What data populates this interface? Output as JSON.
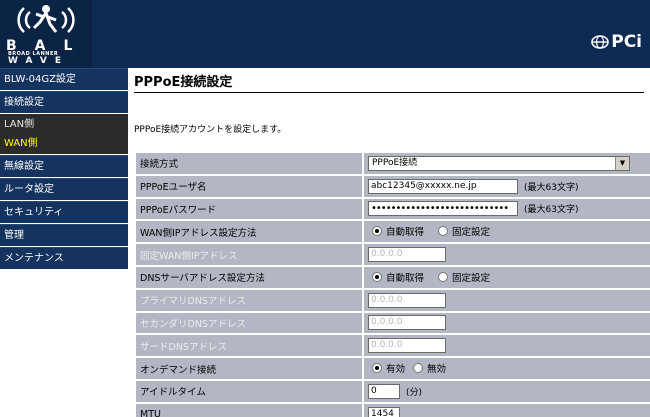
{
  "header": {
    "logo_line1": "BAL",
    "logo_line2": "BROAD LANNER",
    "logo_line3": "WAVE",
    "brand": "PCi"
  },
  "sidebar": {
    "items": [
      {
        "label": "BLW-04GZ設定",
        "type": "main"
      },
      {
        "label": "接続設定",
        "type": "main"
      },
      {
        "label": "LAN側",
        "type": "sub"
      },
      {
        "label": "WAN側",
        "type": "sub",
        "active": true
      },
      {
        "label": "無線設定",
        "type": "main"
      },
      {
        "label": "ルータ設定",
        "type": "main"
      },
      {
        "label": "セキュリティ",
        "type": "main"
      },
      {
        "label": "管理",
        "type": "main"
      },
      {
        "label": "メンテナンス",
        "type": "main"
      }
    ]
  },
  "main": {
    "title": "PPPoE接続設定",
    "description": "PPPoE接続アカウントを設定します。",
    "rows": {
      "connection_method": {
        "label": "接続方式",
        "value": "PPPoE接続"
      },
      "username": {
        "label": "PPPoEユーザ名",
        "value": "abc12345@xxxxx.ne.jp",
        "note": "(最大63文字)"
      },
      "password": {
        "label": "PPPoEパスワード",
        "value": "••••••••••••••••••••••••••••",
        "note": "(最大63文字)"
      },
      "wan_ip_method": {
        "label": "WAN側IPアドレス設定方法",
        "option_auto": "自動取得",
        "option_fixed": "固定設定",
        "selected": "auto"
      },
      "fixed_wan_ip": {
        "label": "固定WAN側IPアドレス",
        "value": "0.0.0.0"
      },
      "dns_method": {
        "label": "DNSサーバアドレス設定方法",
        "option_auto": "自動取得",
        "option_fixed": "固定設定",
        "selected": "auto"
      },
      "primary_dns": {
        "label": "プライマリDNSアドレス",
        "value": "0.0.0.0"
      },
      "secondary_dns": {
        "label": "セカンダリDNSアドレス",
        "value": "0.0.0.0"
      },
      "third_dns": {
        "label": "サードDNSアドレス",
        "value": "0.0.0.0"
      },
      "on_demand": {
        "label": "オンデマンド接続",
        "option_on": "有効",
        "option_off": "無効",
        "selected": "on"
      },
      "idle_time": {
        "label": "アイドルタイム",
        "value": "0",
        "unit": "(分)"
      },
      "mtu": {
        "label": "MTU",
        "value": "1454"
      }
    }
  },
  "colors": {
    "header_bg": "#0d2a52",
    "sidebar_main_bg": "#14335e",
    "sidebar_sub_bg": "#2b2b2b",
    "active_sub_text": "#ffff00",
    "row_bg": "#b3b7c3"
  }
}
